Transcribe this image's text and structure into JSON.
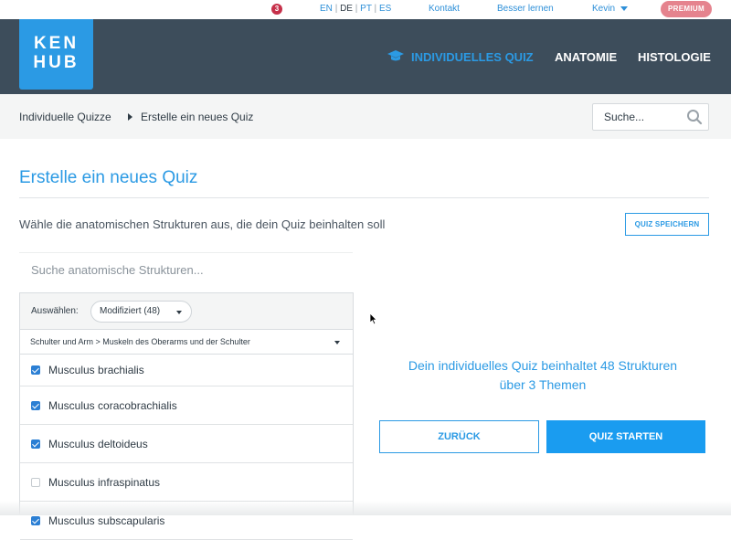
{
  "topbar": {
    "notification_count": "3",
    "languages": [
      "EN",
      "DE",
      "PT",
      "ES"
    ],
    "active_language": "DE",
    "separator": "|",
    "contact": "Kontakt",
    "learn_better": "Besser lernen",
    "user_name": "Kevin",
    "premium": "PREMIUM"
  },
  "logo": {
    "line1": "KEN",
    "line2": "HUB"
  },
  "nav": {
    "items": [
      {
        "label": "INDIVIDUELLES QUIZ",
        "active": true,
        "icon": "graduation-cap-icon"
      },
      {
        "label": "ANATOMIE",
        "active": false
      },
      {
        "label": "HISTOLOGIE",
        "active": false
      }
    ]
  },
  "breadcrumb": {
    "items": [
      "Individuelle Quizze",
      "Erstelle ein neues Quiz"
    ]
  },
  "search": {
    "placeholder": "Suche...",
    "icon": "search-icon"
  },
  "main": {
    "title": "Erstelle ein neues Quiz",
    "subtitle": "Wähle die anatomischen Strukturen aus, die dein Quiz beinhalten soll",
    "save_button": "QUIZ SPEICHERN",
    "structure_search_placeholder": "Suche anatomische Strukturen...",
    "select_label": "Auswählen:",
    "select_value": "Modifiziert (48)",
    "category": "Schulter und Arm > Muskeln des Oberarms und der Schulter",
    "structures": [
      {
        "label": "Musculus brachialis",
        "checked": true
      },
      {
        "label": "Musculus coracobrachialis",
        "checked": true
      },
      {
        "label": "Musculus deltoideus",
        "checked": true
      },
      {
        "label": "Musculus infraspinatus",
        "checked": false
      },
      {
        "label": "Musculus subscapularis",
        "checked": true
      }
    ],
    "summary_line1": "Dein individuelles Quiz beinhaltet 48 Strukturen",
    "summary_line2": "über 3 Themen",
    "back_button": "ZURÜCK",
    "start_button": "QUIZ STARTEN"
  },
  "colors": {
    "accent": "#2b9ae4",
    "nav_bg": "#3d4d5b",
    "premium": "#e5838e",
    "notification": "#c6304a",
    "primary_button": "#1a9cf0"
  }
}
